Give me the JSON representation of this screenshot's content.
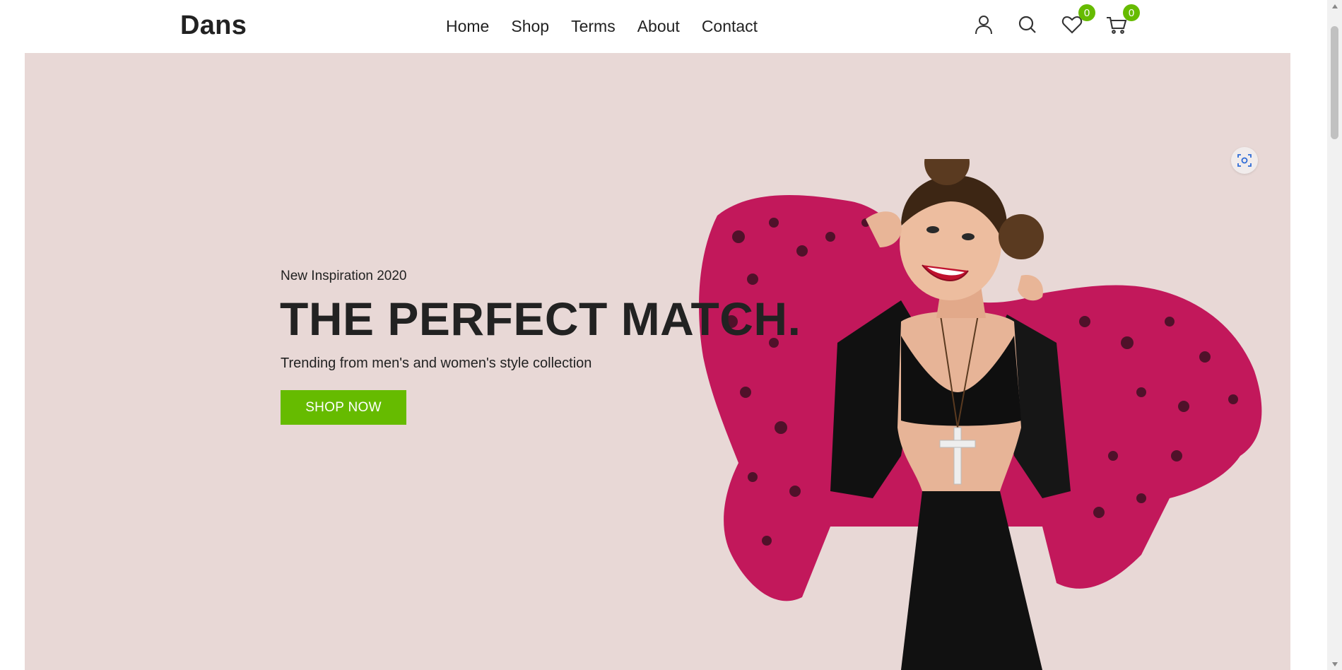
{
  "header": {
    "logo": "Dans",
    "nav": [
      {
        "label": "Home"
      },
      {
        "label": "Shop"
      },
      {
        "label": "Terms"
      },
      {
        "label": "About"
      },
      {
        "label": "Contact"
      }
    ],
    "icons": [
      "user-icon",
      "search-icon",
      "heart-icon",
      "cart-icon"
    ],
    "wishlist_count": "0",
    "cart_count": "0"
  },
  "hero": {
    "subtitle": "New Inspiration 2020",
    "title": "THE PERFECT MATCH.",
    "description": "Trending from men's and women's style collection",
    "button_label": "SHOP NOW"
  },
  "colors": {
    "accent": "#66bb00",
    "hero_bg": "#e8d8d6",
    "text": "#222222",
    "coat": "#c2185b"
  }
}
